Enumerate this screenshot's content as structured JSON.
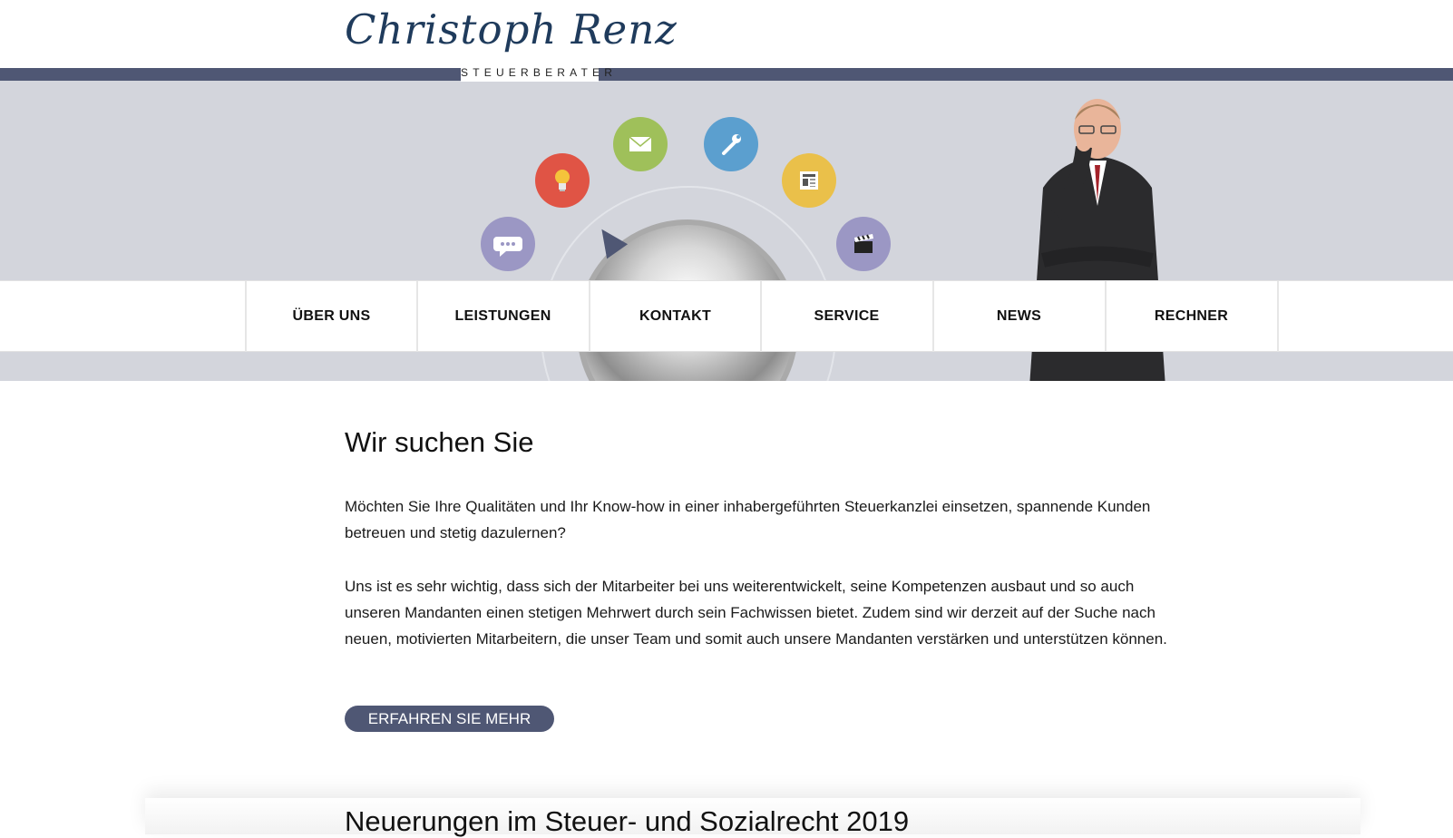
{
  "brand": {
    "name": "Christoph Renz",
    "subtitle": "STEUERBERATER",
    "primary_color": "#4f5774",
    "hero_color": "#d3d5dc"
  },
  "hero": {
    "icons": [
      {
        "name": "speech-bubble-icon",
        "color": "#9b97c4"
      },
      {
        "name": "lightbulb-icon",
        "color": "#e05445"
      },
      {
        "name": "envelope-icon",
        "color": "#9fc05a"
      },
      {
        "name": "wrench-icon",
        "color": "#5b9fcf"
      },
      {
        "name": "newspaper-icon",
        "color": "#eac04a"
      },
      {
        "name": "clapperboard-icon",
        "color": "#9b97c4"
      }
    ]
  },
  "nav": {
    "items": [
      {
        "label": "ÜBER UNS"
      },
      {
        "label": "LEISTUNGEN"
      },
      {
        "label": "KONTAKT"
      },
      {
        "label": "SERVICE"
      },
      {
        "label": "NEWS"
      },
      {
        "label": "RECHNER"
      }
    ]
  },
  "section": {
    "title": "Wir suchen Sie",
    "paragraph1": "Möchten Sie Ihre Qualitäten und Ihr Know-how in einer inhabergeführten Steuerkanzlei einsetzen, spannende Kunden betreuen und stetig dazulernen?",
    "paragraph2": "Uns ist es sehr wichtig, dass sich der Mitarbeiter bei uns weiterentwickelt, seine Kompetenzen ausbaut und so auch unseren Mandanten einen stetigen Mehrwert durch sein Fachwissen bietet. Zudem sind wir derzeit auf der Suche nach neuen, motivierten Mitarbeitern, die unser Team und somit auch unsere Mandanten verstärken und unterstützen können.",
    "button_label": "ERFAHREN SIE MEHR"
  },
  "news": {
    "title": "Neuerungen im Steuer- und Sozialrecht 2019"
  }
}
